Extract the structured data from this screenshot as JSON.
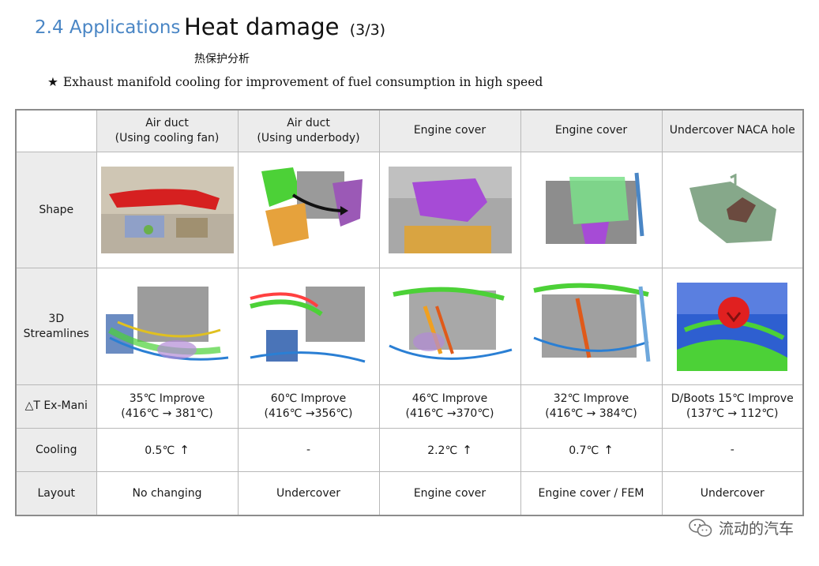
{
  "header": {
    "section": "2.4 Applications",
    "title": "Heat damage",
    "page_indicator": "(3/3)",
    "subtitle": "热保护分析",
    "bullet_symbol": "★",
    "bullet_text": "Exhaust manifold cooling for improvement of fuel consumption in high speed"
  },
  "table": {
    "columns": [
      {
        "line1": "Air duct",
        "line2": "(Using cooling fan)"
      },
      {
        "line1": "Air duct",
        "line2": "(Using underbody)"
      },
      {
        "line1": "Engine cover",
        "line2": ""
      },
      {
        "line1": "Engine cover",
        "line2": ""
      },
      {
        "line1": "Undercover NACA hole",
        "line2": ""
      }
    ],
    "row_labels": {
      "shape": "Shape",
      "streamlines_line1": "3D",
      "streamlines_line2": "Streamlines",
      "delta_t": "△T Ex-Mani",
      "cooling": "Cooling",
      "layout": "Layout"
    },
    "delta_t": [
      {
        "improve": "35℃ Improve",
        "range": "(416℃ → 381℃)"
      },
      {
        "improve": "60℃ Improve",
        "range": "(416℃ →356℃)"
      },
      {
        "improve": "46℃ Improve",
        "range": "(416℃ →370℃)"
      },
      {
        "improve": "32℃ Improve",
        "range": "(416℃ → 384℃)"
      },
      {
        "improve": "D/Boots 15℃ Improve",
        "range": "(137℃ → 112℃)"
      }
    ],
    "cooling": [
      {
        "value": "0.5℃",
        "arrow": "↑"
      },
      {
        "value": "-",
        "arrow": ""
      },
      {
        "value": "2.2℃",
        "arrow": "↑"
      },
      {
        "value": "0.7℃",
        "arrow": "↑"
      },
      {
        "value": "-",
        "arrow": ""
      }
    ],
    "layout": [
      "No changing",
      "Undercover",
      "Engine cover",
      "Engine cover / FEM",
      "Undercover"
    ]
  },
  "watermark": {
    "text": "流动的汽车",
    "icon": "wechat-icon"
  },
  "colors": {
    "section": "#4a86c5",
    "header_bg": "#ececec",
    "border": "#8c8c8c"
  }
}
